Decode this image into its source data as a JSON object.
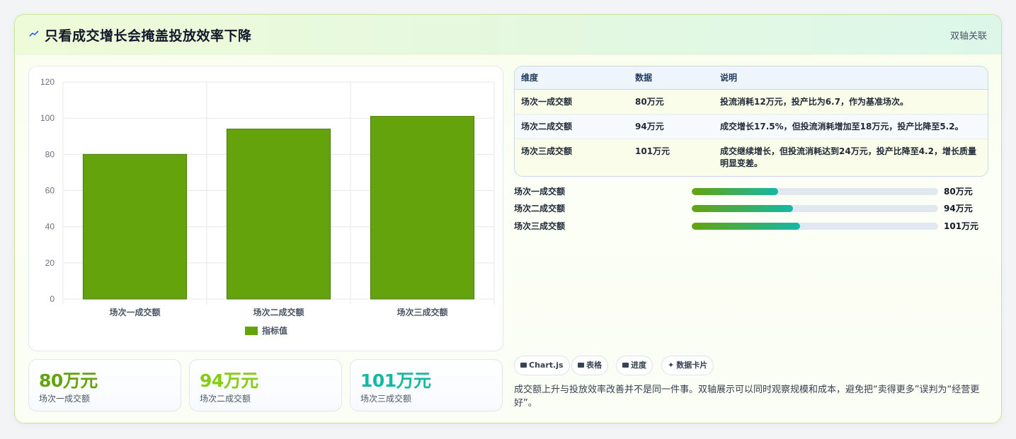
{
  "header": {
    "title": "只看成交增长会掩盖投放效率下降",
    "tag": "双轴关联"
  },
  "chart_data": {
    "type": "bar",
    "categories": [
      "场次一成交额",
      "场次二成交额",
      "场次三成交额"
    ],
    "series": [
      {
        "name": "指标值",
        "values": [
          80,
          94,
          101
        ],
        "color": "#65a30d"
      }
    ],
    "ylim": [
      0,
      120
    ],
    "yticks": [
      0,
      20,
      40,
      60,
      80,
      100,
      120
    ],
    "grid": true,
    "legend": "bottom"
  },
  "stats": [
    {
      "value": "80万元",
      "label": "场次一成交额",
      "color": "#65a30d"
    },
    {
      "value": "94万元",
      "label": "场次二成交额",
      "color": "#84cc16"
    },
    {
      "value": "101万元",
      "label": "场次三成交额",
      "color": "#14b8a6"
    }
  ],
  "table": {
    "headers": [
      "维度",
      "数据",
      "说明"
    ],
    "rows": [
      [
        "场次一成交额",
        "80万元",
        "投流消耗12万元，投产比为6.7，作为基准场次。"
      ],
      [
        "场次二成交额",
        "94万元",
        "成交增长17.5%，但投流消耗增加至18万元，投产比降至5.2。"
      ],
      [
        "场次三成交额",
        "101万元",
        "成交继续增长，但投流消耗达到24万元，投产比降至4.2，增长质量明显变差。"
      ]
    ]
  },
  "progress": [
    {
      "label": "场次一成交额",
      "value": "80万元",
      "fraction": 0.35
    },
    {
      "label": "场次二成交额",
      "value": "94万元",
      "fraction": 0.41
    },
    {
      "label": "场次三成交额",
      "value": "101万元",
      "fraction": 0.44
    }
  ],
  "chips": [
    {
      "label": "Chart.js",
      "icon": "chart-icon"
    },
    {
      "label": "表格",
      "icon": "table-icon"
    },
    {
      "label": "进度",
      "icon": "progress-icon"
    },
    {
      "label": "数据卡片",
      "icon": "sparkle-icon"
    }
  ],
  "note": "成交额上升与投放效率改善并不是同一件事。双轴展示可以同时观察规模和成本，避免把“卖得更多”误判为“经营更好”。"
}
